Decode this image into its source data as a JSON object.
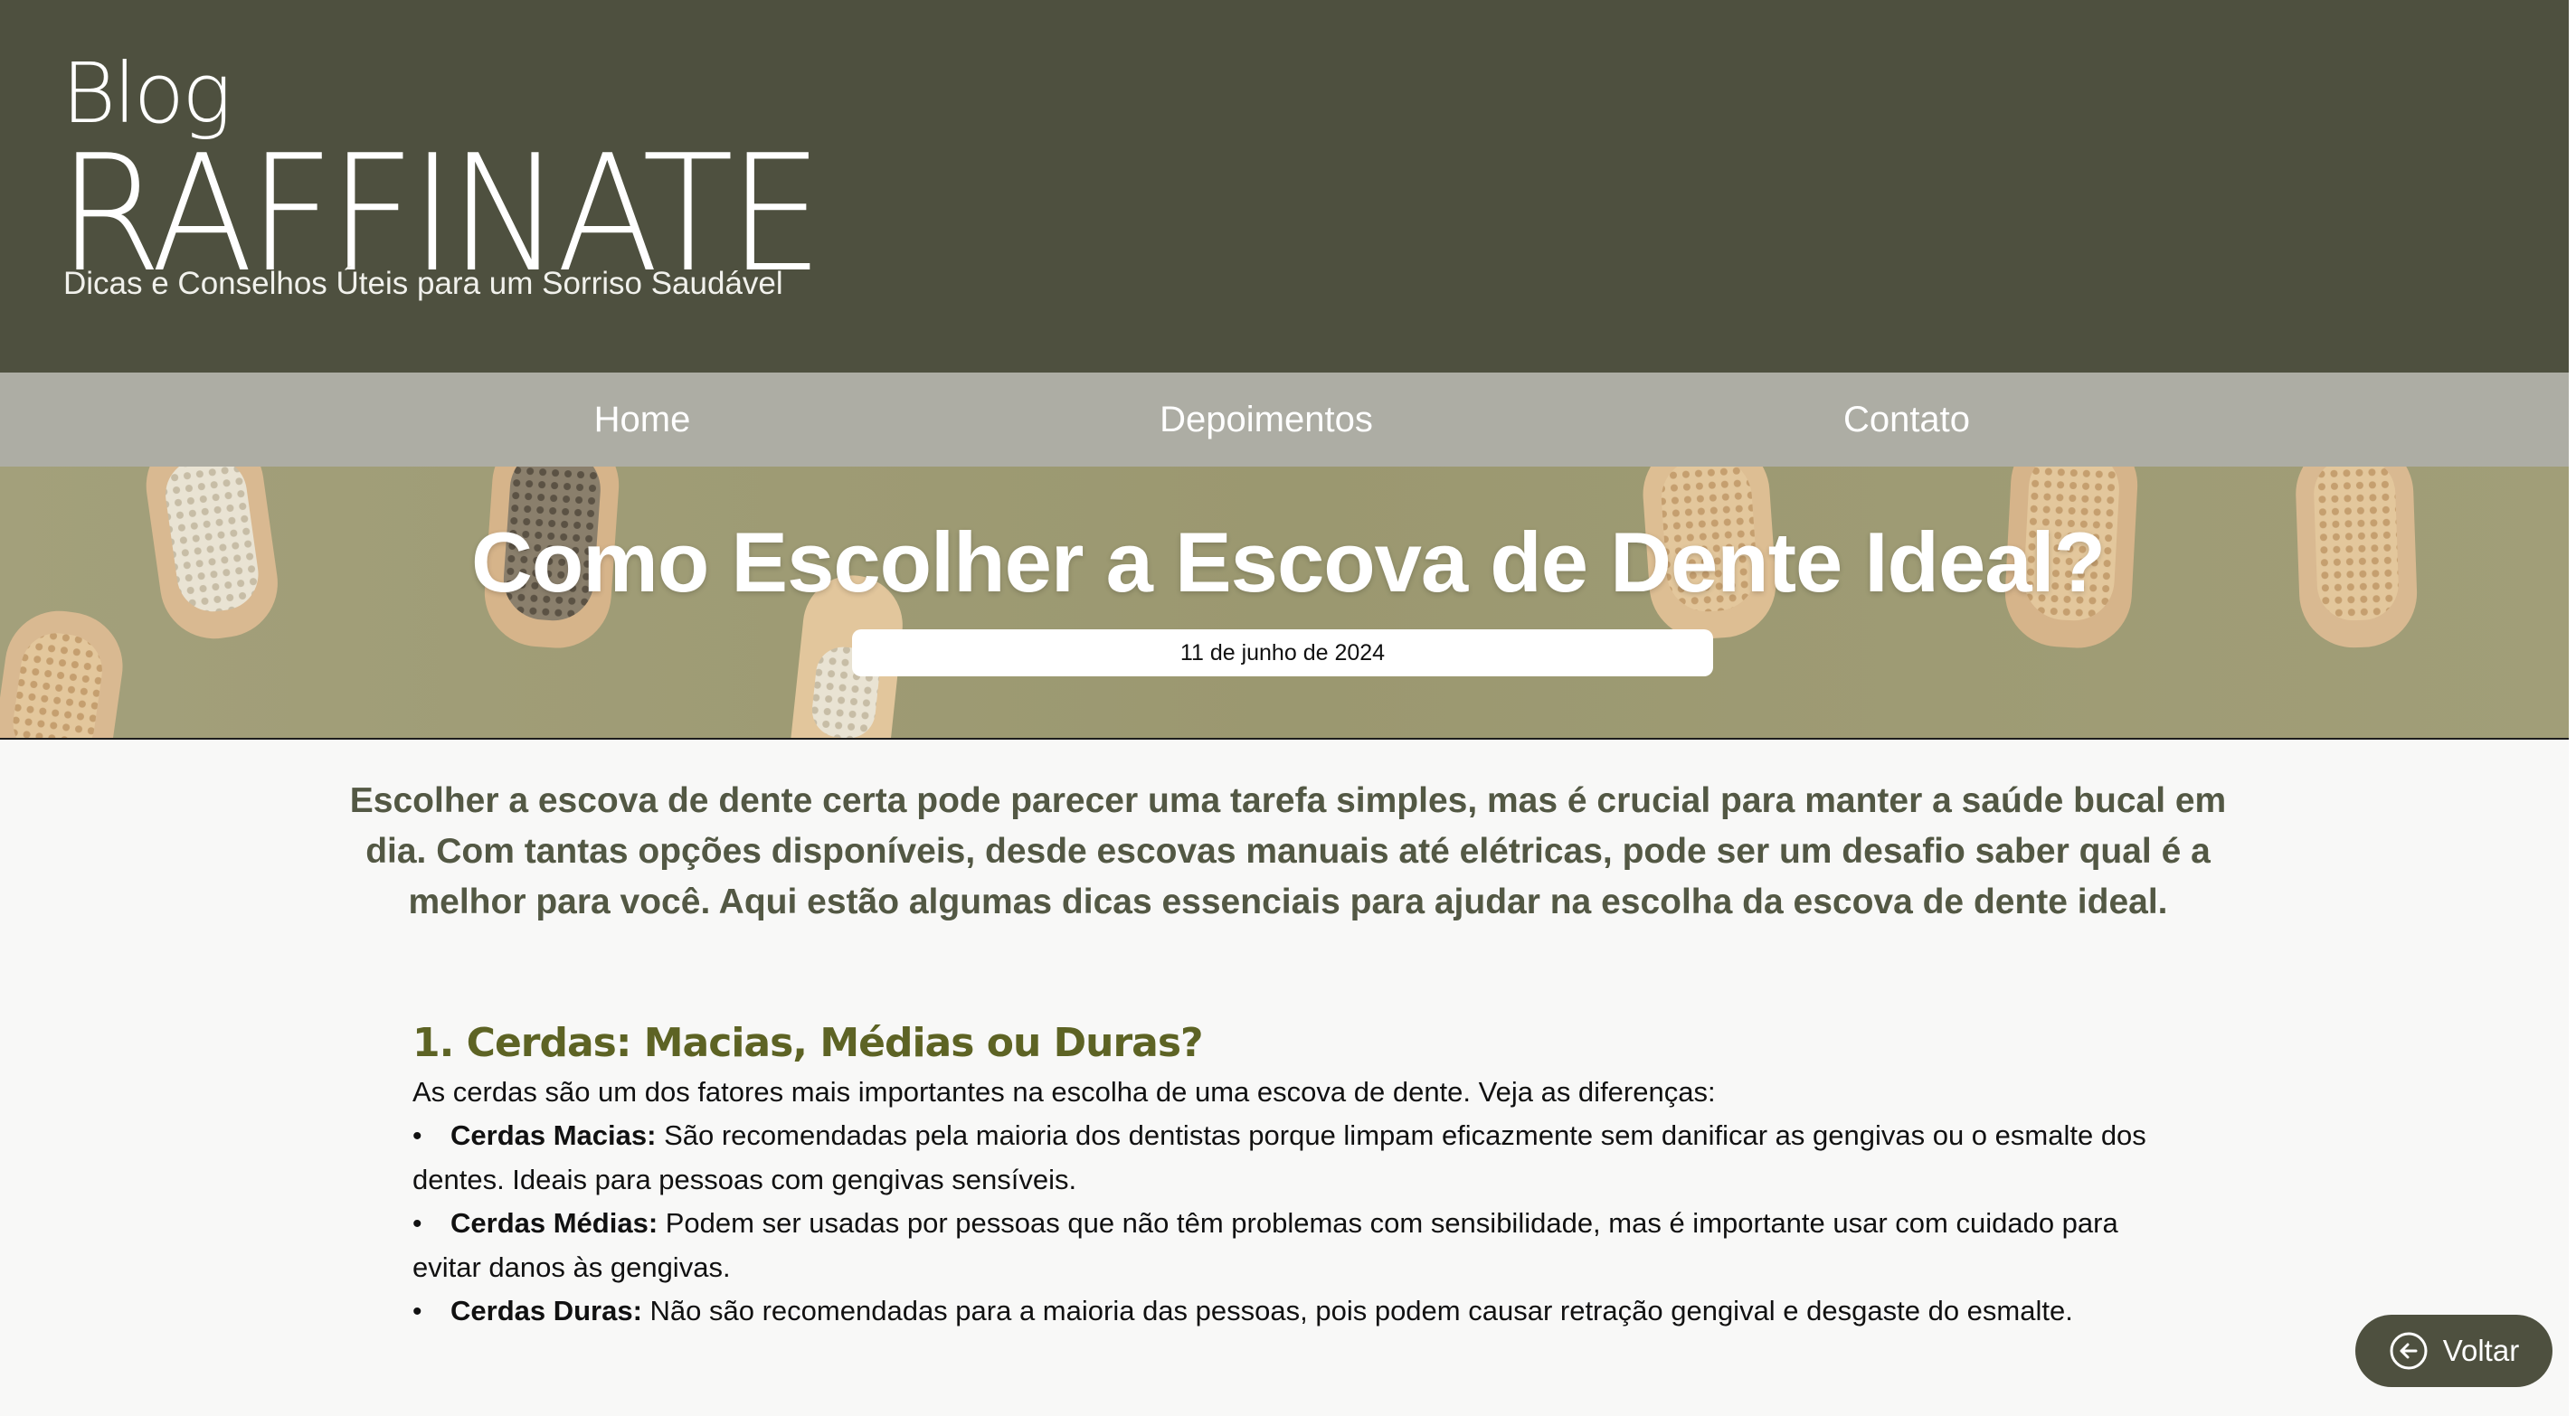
{
  "header": {
    "brand_small": "Blog",
    "brand_large": "RAFFINATE",
    "tagline": "Dicas e Conselhos Úteis para um Sorriso Saudável"
  },
  "nav": {
    "items": [
      {
        "label": "Home"
      },
      {
        "label": "Depoimentos"
      },
      {
        "label": "Contato"
      }
    ]
  },
  "hero": {
    "title": "Como Escolher a Escova de Dente Ideal?",
    "date": "11 de junho de 2024"
  },
  "article": {
    "intro": "Escolher a escova de dente certa pode parecer uma tarefa simples, mas é crucial para manter a saúde bucal em dia. Com tantas opções disponíveis, desde escovas manuais até elétricas, pode ser um desafio saber qual é a melhor para você. Aqui estão algumas dicas essenciais para ajudar na escolha da escova de dente ideal.",
    "section1": {
      "title": "1. Cerdas: Macias, Médias ou Duras?",
      "lead": "As cerdas são um dos fatores mais importantes na escolha de uma escova de dente. Veja as diferenças:",
      "items": [
        {
          "term": "Cerdas Macias:",
          "text": " São recomendadas pela maioria dos dentistas porque limpam eficazmente sem danificar as gengivas ou o esmalte dos dentes. Ideais para pessoas com gengivas sensíveis."
        },
        {
          "term": "Cerdas Médias:",
          "text": " Podem ser usadas por pessoas que não têm problemas com sensibilidade, mas é importante usar com cuidado para evitar danos às gengivas."
        },
        {
          "term": "Cerdas Duras:",
          "text": " Não são recomendadas para a maioria das pessoas, pois podem causar retração gengival e desgaste do esmalte."
        }
      ]
    }
  },
  "back_button": {
    "label": "Voltar",
    "icon": "arrow-left-circle-icon"
  },
  "colors": {
    "header_bg": "#4e503f",
    "nav_bg": "#adada4",
    "hero_bg": "#9c9971",
    "intro_text": "#535844",
    "section_title": "#5d6324"
  }
}
